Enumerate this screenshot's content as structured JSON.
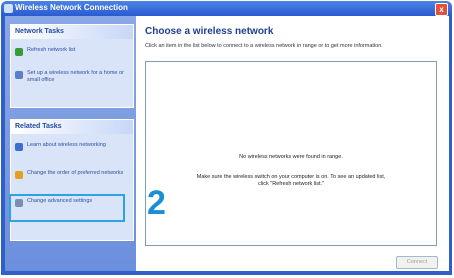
{
  "window": {
    "title": "Wireless Network Connection",
    "close_label": "x"
  },
  "sidebar": {
    "network_tasks": {
      "header": "Network Tasks",
      "items": [
        {
          "label": "Refresh network list",
          "icon": "refresh-icon",
          "color": "#3a9a3a"
        },
        {
          "label": "Set up a wireless network for a home or small office",
          "icon": "wireless-setup-icon",
          "color": "#5a7fc8"
        }
      ]
    },
    "related_tasks": {
      "header": "Related Tasks",
      "items": [
        {
          "label": "Learn about wireless networking",
          "icon": "info-icon",
          "color": "#3b6fcf"
        },
        {
          "label": "Change the order of preferred networks",
          "icon": "star-icon",
          "color": "#e0a21c"
        },
        {
          "label": "Change advanced settings",
          "icon": "settings-icon",
          "color": "#7a8fb5"
        }
      ]
    }
  },
  "main": {
    "heading": "Choose a wireless network",
    "hint": "Click an item in the list below to connect to a wireless network in range or to get more information.",
    "empty_message": "No wireless networks were found in range.",
    "help_message": "Make sure the wireless switch on your computer is on. To see an updated list, click \"Refresh network list.\"",
    "connect_label": "Connect"
  },
  "annotation": {
    "step_number": "2",
    "color": "#1a8fd4"
  }
}
